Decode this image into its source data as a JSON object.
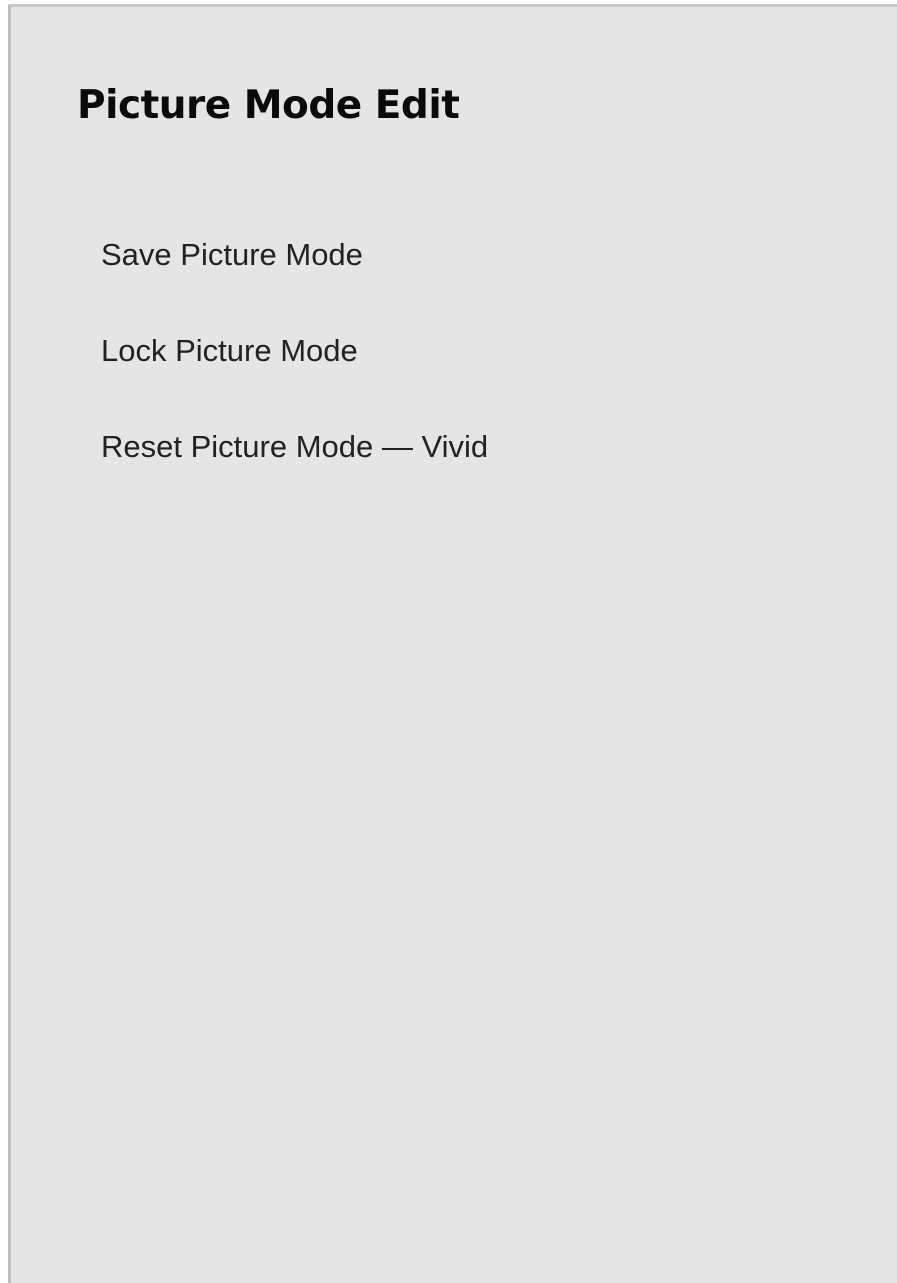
{
  "panel": {
    "title": "Picture Mode Edit",
    "items": [
      {
        "label": "Save Picture Mode"
      },
      {
        "label": "Lock Picture Mode"
      },
      {
        "label": "Reset Picture Mode — Vivid"
      }
    ]
  },
  "colors": {
    "background": "#e5e5e5",
    "border": "#bdbdbd",
    "title_text": "#0a0a0a",
    "item_text": "#222222"
  }
}
